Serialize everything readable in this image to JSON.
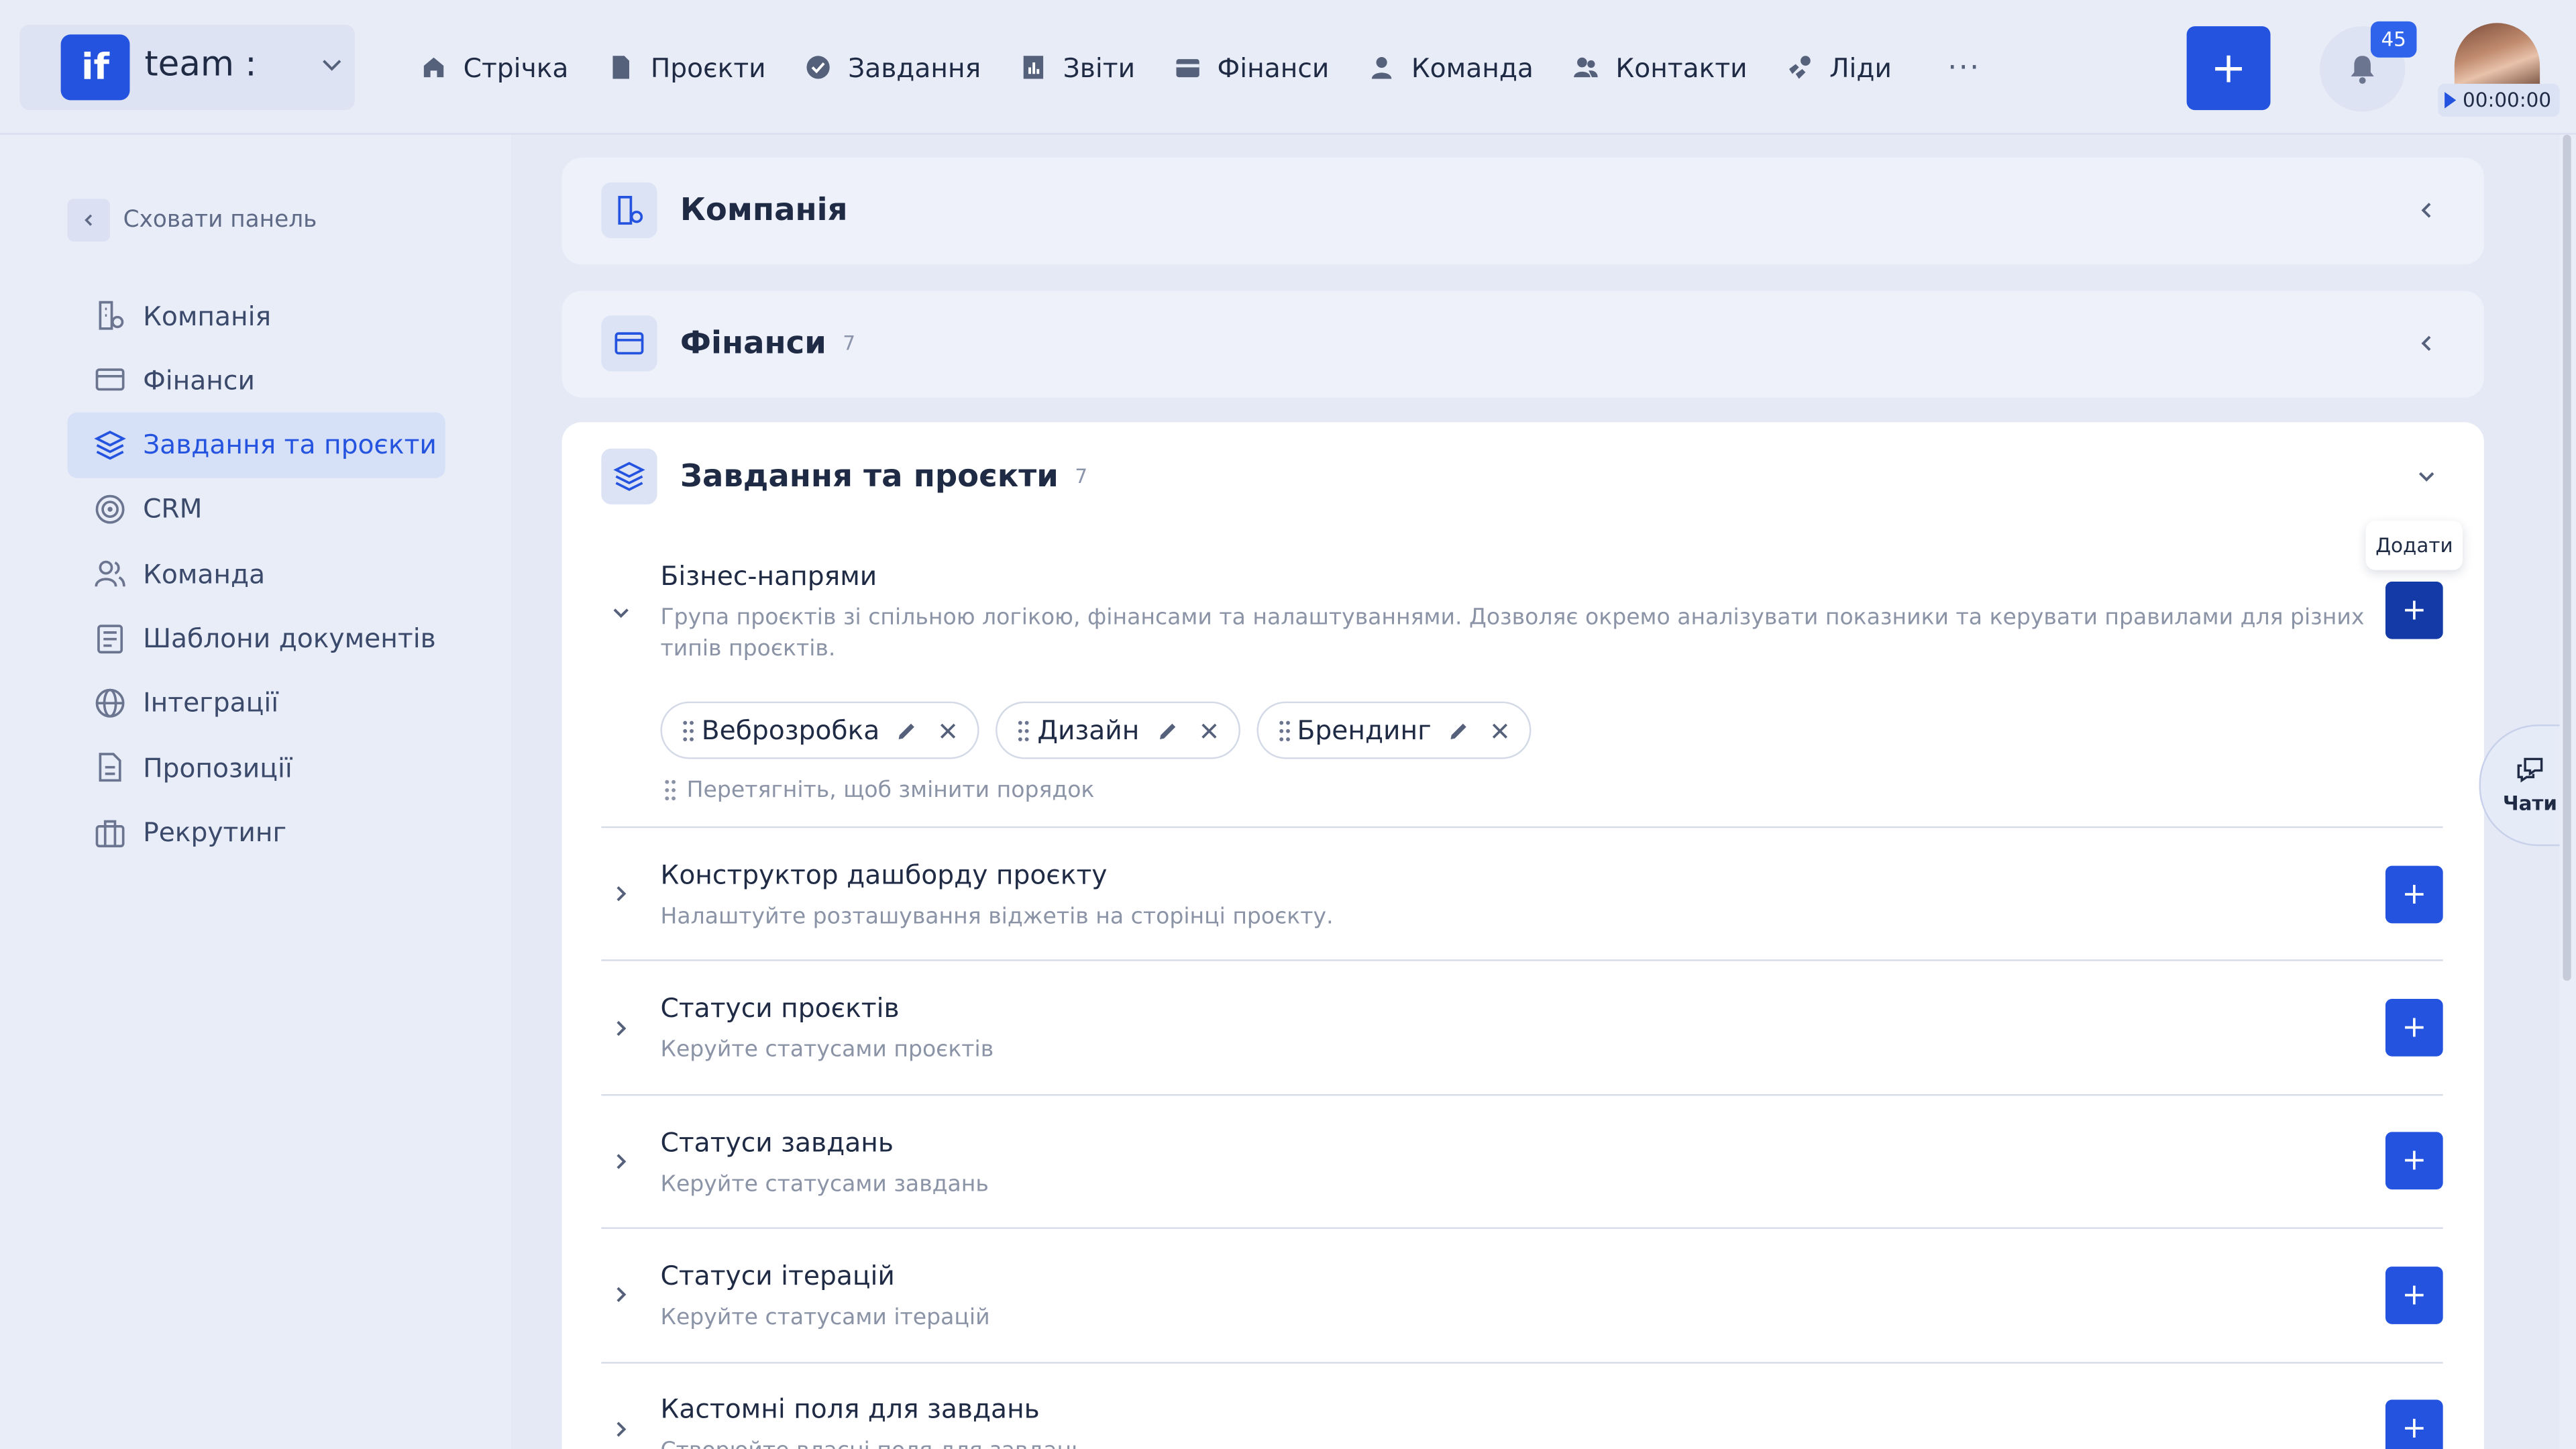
{
  "workspace": {
    "logo": "if",
    "name": "team :"
  },
  "nav": [
    {
      "label": "Стрічка",
      "icon": "home-icon"
    },
    {
      "label": "Проєкти",
      "icon": "document-icon"
    },
    {
      "label": "Завдання",
      "icon": "check-circle-icon"
    },
    {
      "label": "Звіти",
      "icon": "report-icon"
    },
    {
      "label": "Фінанси",
      "icon": "wallet-icon"
    },
    {
      "label": "Команда",
      "icon": "user-icon"
    },
    {
      "label": "Контакти",
      "icon": "contacts-icon"
    },
    {
      "label": "Ліди",
      "icon": "leads-icon"
    }
  ],
  "nav_more": "···",
  "header": {
    "add_label": "+",
    "notifications_count": "45",
    "timer": "00:00:00"
  },
  "sidebar": {
    "hide_label": "Сховати панель",
    "items": [
      {
        "label": "Компанія",
        "icon": "company-settings-icon",
        "active": false
      },
      {
        "label": "Фінанси",
        "icon": "credit-card-icon",
        "active": false
      },
      {
        "label": "Завдання та проєкти",
        "icon": "layers-icon",
        "active": true
      },
      {
        "label": "CRM",
        "icon": "target-icon",
        "active": false
      },
      {
        "label": "Команда",
        "icon": "users-icon",
        "active": false
      },
      {
        "label": "Шаблони документів",
        "icon": "document-template-icon",
        "active": false
      },
      {
        "label": "Інтеграції",
        "icon": "globe-icon",
        "active": false
      },
      {
        "label": "Пропозиції",
        "icon": "proposal-icon",
        "active": false
      },
      {
        "label": "Рекрутинг",
        "icon": "briefcase-icon",
        "active": false
      }
    ]
  },
  "cards": {
    "company": {
      "title": "Компанія"
    },
    "finance": {
      "title": "Фінанси",
      "count": "7"
    },
    "tasks": {
      "title": "Завдання та проєкти",
      "count": "7"
    }
  },
  "sections": [
    {
      "title": "Бізнес-напрями",
      "desc": "Група проєктів зі спільною логікою, фінансами та налаштуваннями. Дозволяє окремо аналізувати показники та керувати правилами для різних типів проєктів.",
      "expanded": true,
      "tags": [
        "Веброзробка",
        "Дизайн",
        "Брендинг"
      ],
      "drag_hint": "Перетягніть, щоб змінити порядок"
    },
    {
      "title": "Конструктор дашборду проєкту",
      "desc": "Налаштуйте розташування віджетів на сторінці проєкту."
    },
    {
      "title": "Статуси проєктів",
      "desc": "Керуйте статусами проєктів"
    },
    {
      "title": "Статуси завдань",
      "desc": "Керуйте статусами завдань"
    },
    {
      "title": "Статуси ітерацій",
      "desc": "Керуйте статусами ітерацій"
    },
    {
      "title": "Кастомні поля для завдань",
      "desc": "Створюйте власні поля для завдань"
    }
  ],
  "tooltip": "Додати",
  "chats_label": "Чати",
  "colors": {
    "accent": "#2453e0",
    "accent_dark": "#143aa8",
    "background": "#e9edf8",
    "active_bg": "#d6e0f7"
  }
}
